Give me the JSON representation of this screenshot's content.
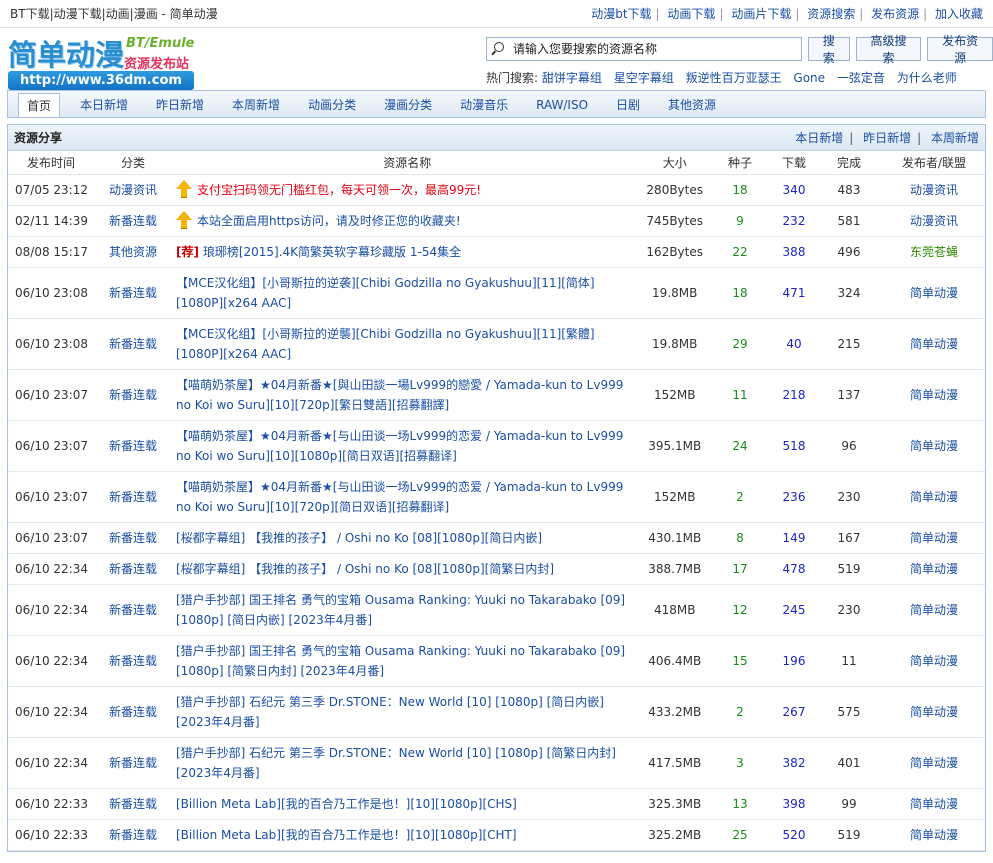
{
  "topbar": {
    "left": "BT下载|动漫下载|动画|漫画 - 简单动漫",
    "links": [
      "动漫bt下载",
      "动画下载",
      "动画片下载",
      "资源搜索",
      "发布资源",
      "加入收藏"
    ]
  },
  "logo": {
    "name": "简单动漫",
    "bt": "BT/Emule",
    "sub": "资源发布站",
    "url": "http://www.36dm.com"
  },
  "search": {
    "placeholder": "请输入您要搜索的资源名称",
    "search_btn": "搜索",
    "advanced_btn": "高级搜索",
    "publish_btn": "发布资源"
  },
  "hot": {
    "label": "热门搜索:",
    "items": [
      "甜饼字幕组",
      "星空字幕组",
      "叛逆性百万亚瑟王",
      "Gone",
      "一弦定音",
      "为什么老师"
    ]
  },
  "nav": {
    "tabs": [
      "首页",
      "本日新增",
      "昨日新增",
      "本周新增",
      "动画分类",
      "漫画分类",
      "动漫音乐",
      "RAW/ISO",
      "日剧",
      "其他资源"
    ]
  },
  "panel": {
    "title": "资源分享",
    "links": [
      "本日新增",
      "昨日新增",
      "本周新增"
    ]
  },
  "table": {
    "headers": [
      "发布时间",
      "分类",
      "资源名称",
      "大小",
      "种子",
      "下载",
      "完成",
      "发布者/联盟"
    ],
    "rows": [
      {
        "time": "07/05 23:12",
        "cat": "动漫资讯",
        "prefix": "",
        "name": "支付宝扫码领无门槛红包，每天可领一次，最高99元!",
        "size": "280Bytes",
        "seed": "18",
        "dl": "340",
        "done": "483",
        "pub": "动漫资讯"
      },
      {
        "time": "02/11 14:39",
        "cat": "新番连载",
        "prefix": "",
        "name": "本站全面启用https访问，请及时修正您的收藏夹!",
        "size": "745Bytes",
        "seed": "9",
        "dl": "232",
        "done": "581",
        "pub": "动漫资讯"
      },
      {
        "time": "08/08 15:17",
        "cat": "其他资源",
        "prefix": "[荐]",
        "name": "琅琊榜[2015].4K简繁英软字幕珍藏版 1-54集全",
        "size": "162Bytes",
        "seed": "22",
        "dl": "388",
        "done": "496",
        "pub": "东莞苍蝇"
      },
      {
        "time": "06/10 23:08",
        "cat": "新番连载",
        "prefix": "",
        "name": "【MCE汉化组】[小哥斯拉的逆袭][Chibi Godzilla no Gyakushuu][11][简体][1080P][x264 AAC]",
        "size": "19.8MB",
        "seed": "18",
        "dl": "471",
        "done": "324",
        "pub": "简单动漫"
      },
      {
        "time": "06/10 23:08",
        "cat": "新番连载",
        "prefix": "",
        "name": "【MCE汉化组】[小哥斯拉的逆襲][Chibi Godzilla no Gyakushuu][11][繁體][1080P][x264 AAC]",
        "size": "19.8MB",
        "seed": "29",
        "dl": "40",
        "done": "215",
        "pub": "简单动漫"
      },
      {
        "time": "06/10 23:07",
        "cat": "新番连载",
        "prefix": "",
        "name": "【喵萌奶茶屋】★04月新番★[與山田談一場Lv999的戀愛 / Yamada-kun to Lv999 no Koi wo Suru][10][720p][繁日雙語][招募翻譯]",
        "size": "152MB",
        "seed": "11",
        "dl": "218",
        "done": "137",
        "pub": "简单动漫"
      },
      {
        "time": "06/10 23:07",
        "cat": "新番连载",
        "prefix": "",
        "name": "【喵萌奶茶屋】★04月新番★[与山田谈一场Lv999的恋爱 / Yamada-kun to Lv999 no Koi wo Suru][10][1080p][简日双语][招募翻译]",
        "size": "395.1MB",
        "seed": "24",
        "dl": "518",
        "done": "96",
        "pub": "简单动漫"
      },
      {
        "time": "06/10 23:07",
        "cat": "新番连载",
        "prefix": "",
        "name": "【喵萌奶茶屋】★04月新番★[与山田谈一场Lv999的恋爱 / Yamada-kun to Lv999 no Koi wo Suru][10][720p][简日双语][招募翻译]",
        "size": "152MB",
        "seed": "2",
        "dl": "236",
        "done": "230",
        "pub": "简单动漫"
      },
      {
        "time": "06/10 23:07",
        "cat": "新番连载",
        "prefix": "",
        "name": "[桜都字幕组] 【我推的孩子】 / Oshi no Ko [08][1080p][简日内嵌]",
        "size": "430.1MB",
        "seed": "8",
        "dl": "149",
        "done": "167",
        "pub": "简单动漫"
      },
      {
        "time": "06/10 22:34",
        "cat": "新番连载",
        "prefix": "",
        "name": "[桜都字幕组] 【我推的孩子】 / Oshi no Ko [08][1080p][简繁日内封]",
        "size": "388.7MB",
        "seed": "17",
        "dl": "478",
        "done": "519",
        "pub": "简单动漫"
      },
      {
        "time": "06/10 22:34",
        "cat": "新番连载",
        "prefix": "",
        "name": "[猎户手抄部] 国王排名 勇气的宝箱 Ousama Ranking: Yuuki no Takarabako [09][1080p] [简日内嵌] [2023年4月番]",
        "size": "418MB",
        "seed": "12",
        "dl": "245",
        "done": "230",
        "pub": "简单动漫"
      },
      {
        "time": "06/10 22:34",
        "cat": "新番连载",
        "prefix": "",
        "name": "[猎户手抄部] 国王排名 勇气的宝箱 Ousama Ranking: Yuuki no Takarabako [09][1080p] [简繁日内封] [2023年4月番]",
        "size": "406.4MB",
        "seed": "15",
        "dl": "196",
        "done": "11",
        "pub": "简单动漫"
      },
      {
        "time": "06/10 22:34",
        "cat": "新番连载",
        "prefix": "",
        "name": "[猎户手抄部] 石纪元 第三季 Dr.STONE：New World [10] [1080p] [简日内嵌] [2023年4月番]",
        "size": "433.2MB",
        "seed": "2",
        "dl": "267",
        "done": "575",
        "pub": "简单动漫"
      },
      {
        "time": "06/10 22:34",
        "cat": "新番连载",
        "prefix": "",
        "name": "[猎户手抄部] 石纪元 第三季 Dr.STONE：New World [10] [1080p] [简繁日内封] [2023年4月番]",
        "size": "417.5MB",
        "seed": "3",
        "dl": "382",
        "done": "401",
        "pub": "简单动漫"
      },
      {
        "time": "06/10 22:33",
        "cat": "新番连载",
        "prefix": "",
        "name": "[Billion Meta Lab][我的百合乃工作是也！][10][1080p][CHS]",
        "size": "325.3MB",
        "seed": "13",
        "dl": "398",
        "done": "99",
        "pub": "简单动漫"
      },
      {
        "time": "06/10 22:33",
        "cat": "新番连载",
        "prefix": "",
        "name": "[Billion Meta Lab][我的百合乃工作是也！][10][1080p][CHT]",
        "size": "325.2MB",
        "seed": "25",
        "dl": "520",
        "done": "519",
        "pub": "简单动漫"
      }
    ]
  },
  "colors": {
    "link": "#1a4fa3",
    "red_notice": "#e60012",
    "seed_green": "#1b8a1b",
    "download_blue": "#1a25c4",
    "border": "#a9c2dd"
  }
}
